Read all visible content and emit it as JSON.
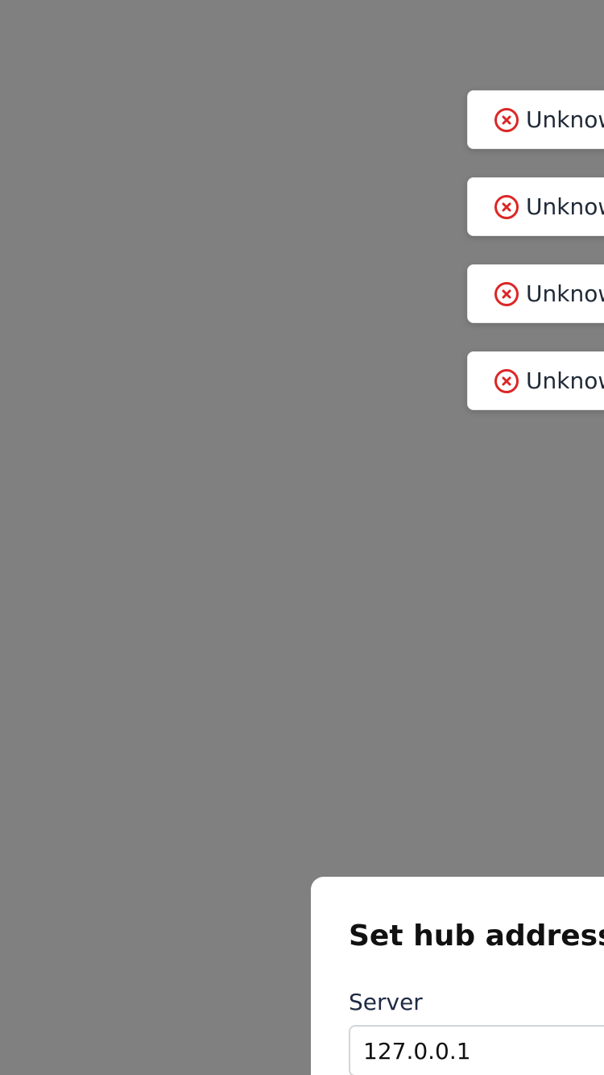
{
  "toasts": [
    {
      "text": "Unknown error",
      "icon": "error-circle-icon"
    },
    {
      "text": "Unknown error",
      "icon": "error-circle-icon"
    },
    {
      "text": "Unknown error",
      "icon": "error-circle-icon"
    },
    {
      "text": "Unknown error",
      "icon": "error-circle-icon"
    }
  ],
  "dialog": {
    "title": "Set hub address",
    "server_label": "Server",
    "server_value": "127.0.0.1"
  },
  "colors": {
    "overlay": "#808080",
    "error": "#dc2626",
    "surface": "#ffffff"
  }
}
